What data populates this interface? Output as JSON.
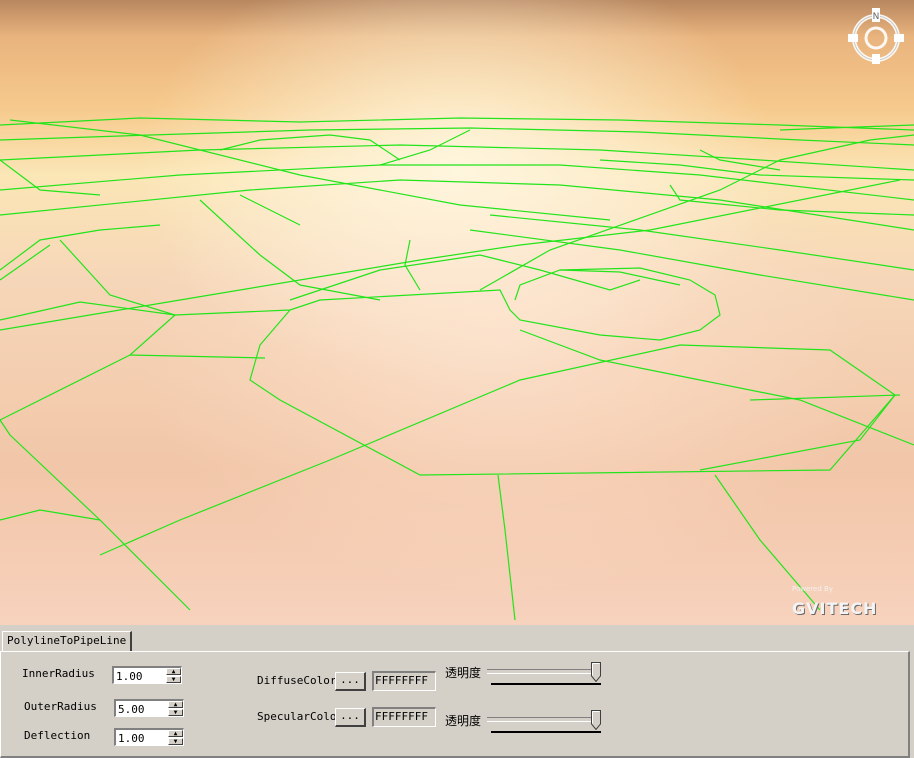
{
  "viewport": {
    "compass_label": "N",
    "brand": {
      "powered_by": "Powered By",
      "name": "GVITECH"
    },
    "colors": {
      "sky_top": "#f0c79f",
      "sky_bottom": "#f7d8c7",
      "road_lines": "#22e41a"
    }
  },
  "tab": {
    "label": "PolylineToPipeLine"
  },
  "form": {
    "inner_radius": {
      "label": "InnerRadius",
      "value": "1.00"
    },
    "outer_radius": {
      "label": "OuterRadius",
      "value": "5.00"
    },
    "deflection": {
      "label": "Deflection",
      "value": "1.00"
    },
    "diffuse": {
      "label": "DiffuseColor",
      "button": "...",
      "value": "FFFFFFFF",
      "transparency_label": "透明度",
      "transparency_value": 1.0
    },
    "specular": {
      "label": "SpecularColor",
      "button": "...",
      "value": "FFFFFFFF",
      "transparency_label": "透明度",
      "transparency_value": 1.0
    }
  }
}
